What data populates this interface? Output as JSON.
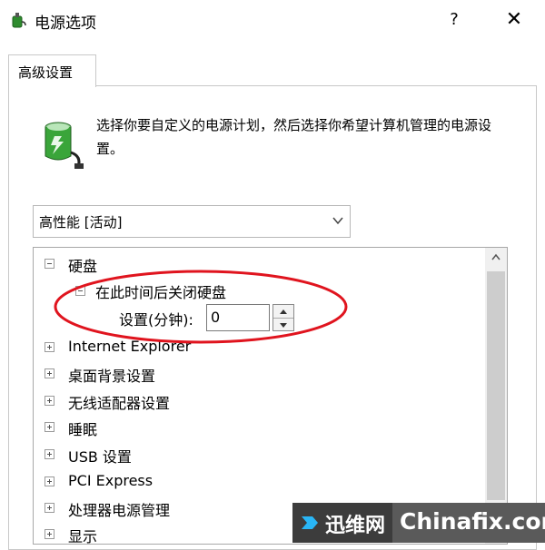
{
  "window": {
    "title": "电源选项",
    "help_label": "?",
    "close_label": "✕"
  },
  "tab": {
    "label": "高级设置"
  },
  "description": "选择你要自定义的电源计划，然后选择你希望计算机管理的电源设置。",
  "plan_select": {
    "value": "高性能 [活动]"
  },
  "tree": {
    "top_item": {
      "label": "硬盘",
      "state": "expanded"
    },
    "sub_item": {
      "label": "在此时间后关闭硬盘"
    },
    "setting": {
      "label": "设置(分钟):",
      "value": "0"
    },
    "items": [
      {
        "label": "Internet Explorer"
      },
      {
        "label": "桌面背景设置"
      },
      {
        "label": "无线适配器设置"
      },
      {
        "label": "睡眠"
      },
      {
        "label": "USB 设置"
      },
      {
        "label": "PCI Express"
      },
      {
        "label": "处理器电源管理"
      },
      {
        "label": "显示"
      }
    ]
  },
  "annotation": {
    "color": "#e0141e"
  },
  "watermark": {
    "brand_cn": "迅维网",
    "brand_en": "Chinafix.com"
  },
  "colors": {
    "accent": "#e0141e",
    "watermark_bg": "#5a5a5a"
  }
}
